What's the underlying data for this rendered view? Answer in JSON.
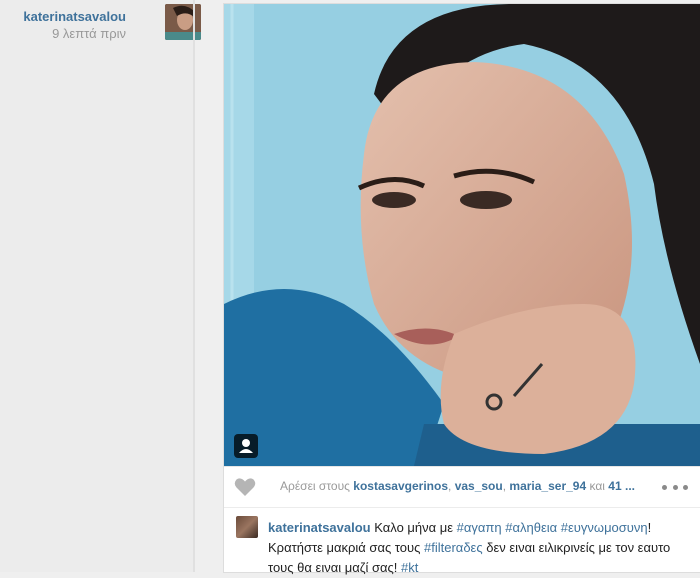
{
  "author": {
    "username": "katerinatsavalou",
    "time_ago": "9 λεπτά πριν"
  },
  "likes": {
    "prefix": "Αρέσει στους",
    "users": [
      "kostasavgerinos",
      "vas_sou",
      "maria_ser_94"
    ],
    "separator": ",",
    "and_label": "και",
    "more_count": "41 ..."
  },
  "caption": {
    "username": "katerinatsavalou",
    "segments": [
      {
        "text": "Καλο μήνα με ",
        "tag": false
      },
      {
        "text": "#αγαπη",
        "tag": true
      },
      {
        "text": " ",
        "tag": false
      },
      {
        "text": "#αληθεια",
        "tag": true
      },
      {
        "text": " ",
        "tag": false
      },
      {
        "text": "#ευγνωμοσυνη",
        "tag": true
      },
      {
        "text": "! Κρατήστε μακριά σας τους ",
        "tag": false
      },
      {
        "text": "#filterαδες",
        "tag": true
      },
      {
        "text": " δεν ειναι ειλικρινείς με τον εαυτο τους θα ειναι μαζί σας! ",
        "tag": false
      },
      {
        "text": "#kt",
        "tag": true
      }
    ]
  },
  "icons": {
    "like": "heart-icon",
    "more": "more-dots-icon",
    "tagged_people": "user-tag-icon"
  },
  "colors": {
    "link": "#3f729b",
    "muted": "#999999"
  }
}
